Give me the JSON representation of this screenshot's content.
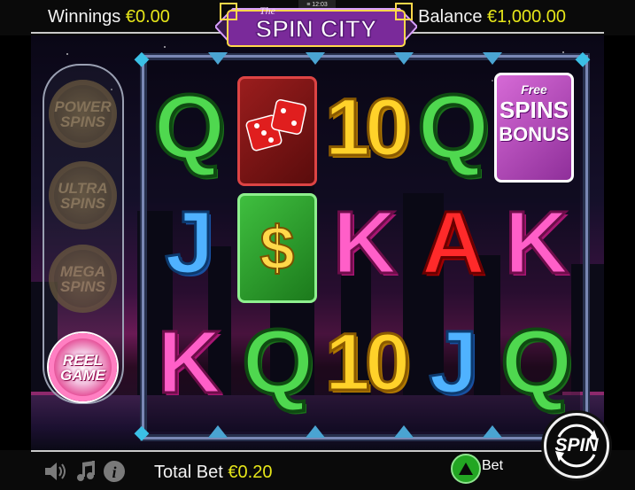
{
  "header": {
    "winnings_label": "Winnings",
    "winnings_value": "€0.00",
    "balance_label": "Balance",
    "balance_value": "€1,000.00",
    "status_time": "12:03"
  },
  "logo": {
    "prefix": "The",
    "title": "SPIN CITY"
  },
  "side_features": [
    {
      "line1": "POWER",
      "line2": "SPINS",
      "state": "dim"
    },
    {
      "line1": "ULTRA",
      "line2": "SPINS",
      "state": "dim"
    },
    {
      "line1": "MEGA",
      "line2": "SPINS",
      "state": "dim"
    },
    {
      "line1": "REEL",
      "line2": "GAME",
      "state": "active"
    }
  ],
  "reels": {
    "rows": [
      [
        "Q",
        "dice",
        "10",
        "Q",
        "bonus"
      ],
      [
        "J",
        "$",
        "K",
        "A",
        "K"
      ],
      [
        "K",
        "Q",
        "10",
        "J",
        "Q"
      ]
    ],
    "bonus_text": {
      "line1": "Free",
      "line2": "SPINS",
      "line3": "BONUS"
    },
    "dollar_text": "$"
  },
  "footer": {
    "total_bet_label": "Total Bet",
    "total_bet_value": "€0.20",
    "bet_label": "Bet",
    "spin_label": "SPIN"
  },
  "icons": {
    "sound": "speaker-icon",
    "music": "music-note-icon",
    "info": "info-icon",
    "bet_up": "triangle-up-icon",
    "spin": "spin-arrows-icon"
  },
  "colors": {
    "accent_yellow": "#e6e619",
    "q_green": "#4fd84f",
    "ten_yellow": "#ffd22a",
    "j_blue": "#4fb2ff",
    "k_pink": "#ff5fc8",
    "a_red": "#ff2a2a",
    "reel_game_pink": "#e0287f"
  }
}
